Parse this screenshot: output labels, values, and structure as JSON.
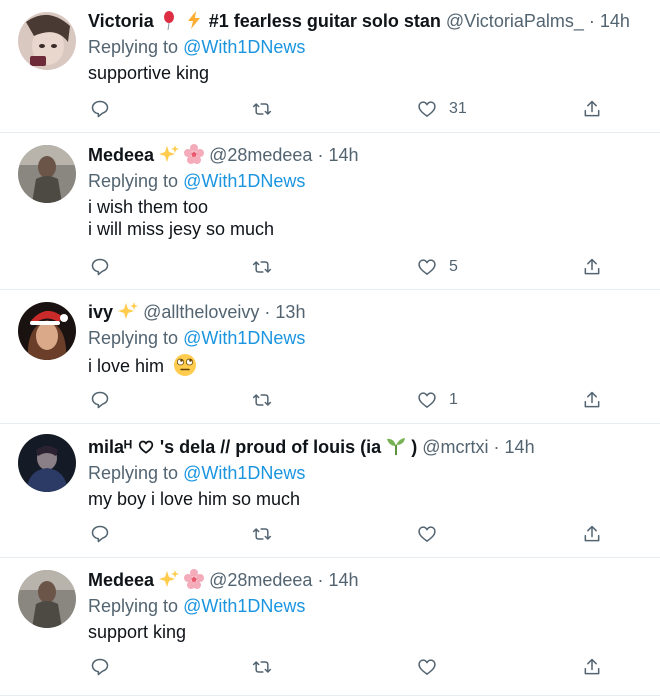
{
  "replies": [
    {
      "name": "Victoria",
      "name_suffix": "#1 fearless guitar solo stan",
      "handle": "@VictoriaPalms_",
      "time": "14h",
      "replying_prefix": "Replying to",
      "replying_to": "@With1DNews",
      "text_lines": [
        "supportive king"
      ],
      "likes": "31"
    },
    {
      "name": "Medeea",
      "handle": "@28medeea",
      "time": "14h",
      "replying_prefix": "Replying to",
      "replying_to": "@With1DNews",
      "text_lines": [
        "i wish them too",
        "i will miss jesy so much"
      ],
      "likes": "5"
    },
    {
      "name": "ivy",
      "handle": "@alltheloveivy",
      "time": "13h",
      "replying_prefix": "Replying to",
      "replying_to": "@With1DNews",
      "text_lines": [
        "i love him"
      ],
      "likes": "1"
    },
    {
      "name": "milaᴴ",
      "name_suffix": "'s dela // proud of louis (ia",
      "name_end": ")",
      "handle": "@mcrtxi",
      "time": "14h",
      "replying_prefix": "Replying to",
      "replying_to": "@With1DNews",
      "text_lines": [
        "my boy i love him so much"
      ],
      "likes": ""
    },
    {
      "name": "Medeea",
      "handle": "@28medeea",
      "time": "14h",
      "replying_prefix": "Replying to",
      "replying_to": "@With1DNews",
      "text_lines": [
        "support king"
      ],
      "likes": ""
    }
  ],
  "icons": {
    "reply": "reply-icon",
    "retweet": "retweet-icon",
    "like": "heart-icon",
    "share": "share-icon"
  },
  "colors": {
    "mention": "#1b95e0",
    "muted": "#536471",
    "divider": "#e6ecf0"
  }
}
